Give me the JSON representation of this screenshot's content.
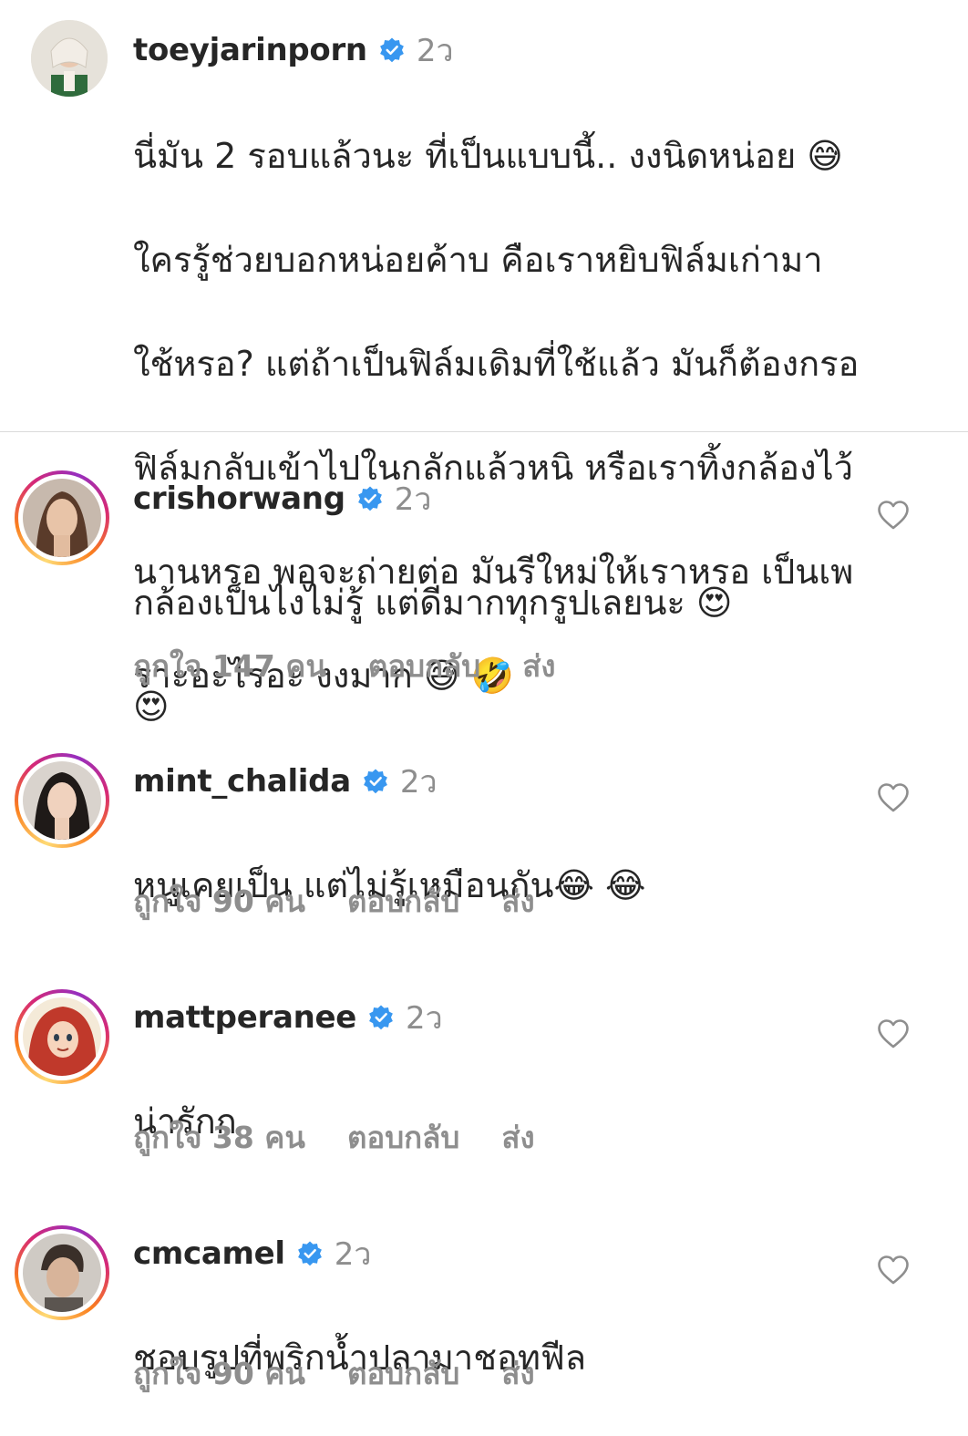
{
  "caption": {
    "username": "toeyjarinporn",
    "time": "2ว",
    "lines": [
      "นี่มัน 2 รอบแล้วนะ ที่เป็นแบบนี้.. งงนิดหน่อย 😅",
      "ใครรู้ช่วยบอกหน่อยค้าบ คือเราหยิบฟิล์มเก่ามา",
      "ใช้หรอ? แต่ถ้าเป็นฟิล์มเดิมที่ใช้แล้ว มันก็ต้องกรอ",
      "ฟิล์มกลับเข้าไปในกลักแล้วหนิ หรือเราทิ้งกล้องไว้",
      "นานหรอ พอจะถ่ายต่อ มันรีใหม่ให้เราหรอ เป็นเพ",
      "ราะอะไรอะ งงมาก 😅 🤣"
    ]
  },
  "comments": [
    {
      "username": "crishorwang",
      "time": "2ว",
      "lines": [
        "กล้องเป็นไงไม่รู้ แต่ดีมากทุกรูปเลยนะ 😍",
        "😍"
      ],
      "likes": "ถูกใจ 147 คน",
      "reply": "ตอบกลับ",
      "send": "ส่ง"
    },
    {
      "username": "mint_chalida",
      "time": "2ว",
      "lines": [
        "หนูเคยเป็น แต่ไม่รู้เหมือนกัน😂 😂"
      ],
      "likes": "ถูกใจ 90 คน",
      "reply": "ตอบกลับ",
      "send": "ส่ง"
    },
    {
      "username": "mattperanee",
      "time": "2ว",
      "lines": [
        "น่ารักก"
      ],
      "likes": "ถูกใจ 38 คน",
      "reply": "ตอบกลับ",
      "send": "ส่ง"
    },
    {
      "username": "cmcamel",
      "time": "2ว",
      "lines": [
        "ชอบรูปที่พริกน้ำปลามาชอทฟีล"
      ],
      "likes": "ถูกใจ 90 คน",
      "reply": "ตอบกลับ",
      "send": "ส่ง"
    }
  ],
  "colors": {
    "verified": "#3897f0",
    "secondary_text": "#8e8e8e",
    "primary_text": "#262626",
    "divider": "#dbdbdb"
  },
  "icons": {
    "verified": "verified-badge-icon",
    "like": "heart-outline-icon"
  }
}
